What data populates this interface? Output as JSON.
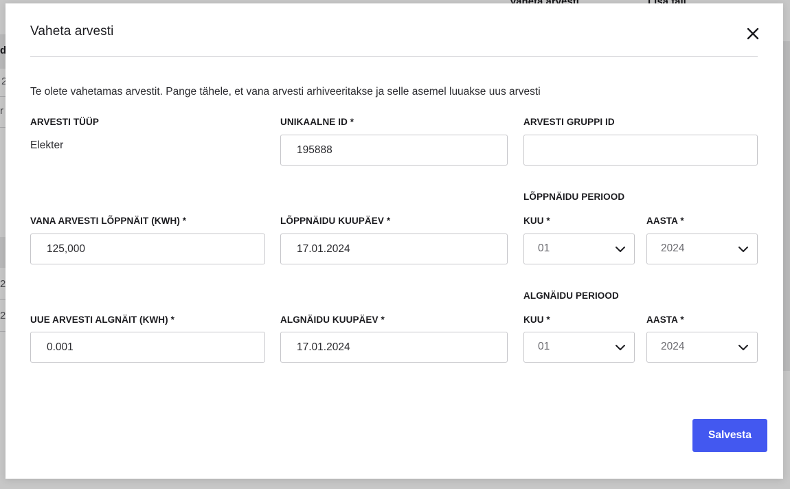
{
  "background": {
    "top_buttons": [
      "Vaheta arvesti",
      "Lisa fail"
    ],
    "left_fragments": [
      "d",
      "2",
      "r",
      "2",
      "2"
    ]
  },
  "modal": {
    "title": "Vaheta arvesti",
    "intro": "Te olete vahetamas arvestit. Pange tähele, et vana arvesti arhiveeritakse ja selle asemel luuakse uus arvesti",
    "meter_type": {
      "label": "ARVESTI TÜÜP",
      "value": "Elekter"
    },
    "unique_id": {
      "label": "UNIKAALNE ID *",
      "value": "195888"
    },
    "group_id": {
      "label": "ARVESTI GRUPPI ID",
      "value": ""
    },
    "old_reading": {
      "label": "VANA ARVESTI LÕPPNÄIT (KWH) *",
      "value": "125,000"
    },
    "end_date": {
      "label": "LÕPPNÄIDU KUUPÄEV *",
      "value": "17.01.2024"
    },
    "end_period": {
      "heading": "LÕPPNÄIDU PERIOOD",
      "month_label": "KUU *",
      "month_value": "01",
      "year_label": "AASTA *",
      "year_value": "2024"
    },
    "new_reading": {
      "label": "UUE ARVESTI ALGNÄIT (KWH) *",
      "value": "0.001"
    },
    "start_date": {
      "label": "ALGNÄIDU KUUPÄEV *",
      "value": "17.01.2024"
    },
    "start_period": {
      "heading": "ALGNÄIDU PERIOOD",
      "month_label": "KUU *",
      "month_value": "01",
      "year_label": "AASTA *",
      "year_value": "2024"
    },
    "save_label": "Salvesta"
  },
  "colors": {
    "primary": "#4358f0",
    "border": "#c6c6ca",
    "text": "#1b1b1f"
  }
}
